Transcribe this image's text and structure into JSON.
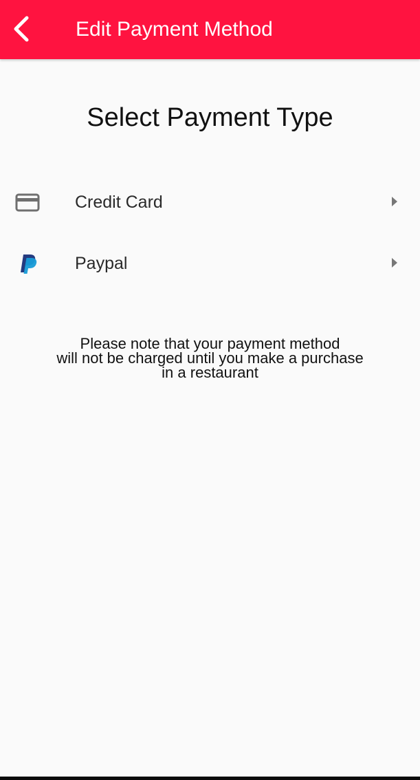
{
  "app_bar": {
    "title": "Edit Payment Method",
    "background_color": "#ff1340",
    "back_icon": "chevron-left-icon"
  },
  "main": {
    "heading": "Select Payment Type",
    "options": [
      {
        "label": "Credit Card",
        "icon": "credit-card-icon",
        "chevron": "chevron-right-icon"
      },
      {
        "label": "Paypal",
        "icon": "paypal-icon",
        "chevron": "chevron-right-icon"
      }
    ],
    "note_lines": [
      "Please note that your payment method",
      "will not be charged until you make a purchase",
      "in a restaurant"
    ]
  }
}
